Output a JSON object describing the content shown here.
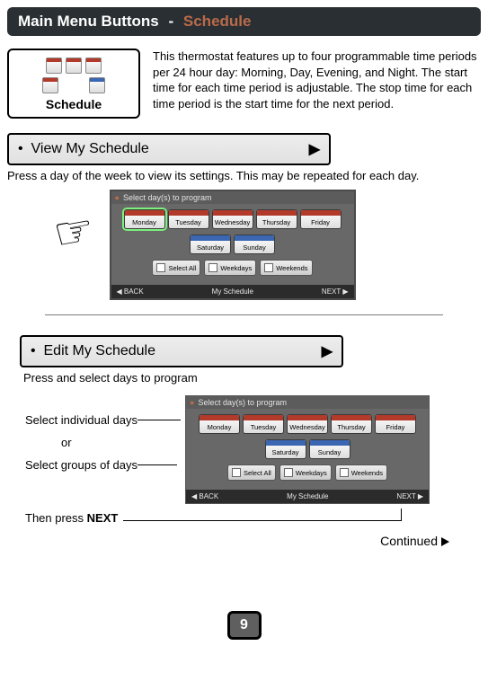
{
  "title_bar": {
    "main": "Main Menu Buttons",
    "sep": " - ",
    "crumb": "Schedule"
  },
  "tile": {
    "label": "Schedule"
  },
  "intro_text": "This thermostat features up to four programmable time periods per 24 hour day: Morning, Day, Evening, and Night. The start time for each time period is adjustable. The stop time for each time period is the start time for the next period.",
  "menu_view": {
    "bullet": "•",
    "label": "View My Schedule",
    "arrow": "▶"
  },
  "view_text": "Press a day of the week to view its settings. This may be repeated for each day.",
  "thermo1": {
    "top_bar": "Select day(s) to program",
    "days": [
      "Monday",
      "Tuesday",
      "Wednesday",
      "Thursday",
      "Friday"
    ],
    "weekend": [
      "Saturday",
      "Sunday"
    ],
    "groups": [
      "Select All",
      "Weekdays",
      "Weekends"
    ],
    "footer_left": "◀ BACK",
    "footer_center": "My Schedule",
    "footer_right": "NEXT ▶"
  },
  "menu_edit": {
    "bullet": "•",
    "label": "Edit My Schedule",
    "arrow": "▶"
  },
  "edit_text": "Press and select days to program",
  "edit_labels": {
    "ind": "Select individual days",
    "or": "or",
    "grp": "Select groups of days"
  },
  "next_prefix": "Then press ",
  "next_bold": "NEXT",
  "thermo2": {
    "top_bar": "Select day(s) to program",
    "days": [
      "Monday",
      "Tuesday",
      "Wednesday",
      "Thursday",
      "Friday"
    ],
    "weekend": [
      "Saturday",
      "Sunday"
    ],
    "groups": [
      "Select All",
      "Weekdays",
      "Weekends"
    ],
    "footer_left": "◀ BACK",
    "footer_center": "My Schedule",
    "footer_right": "NEXT ▶"
  },
  "continued_label": "Continued",
  "page_number": "9"
}
